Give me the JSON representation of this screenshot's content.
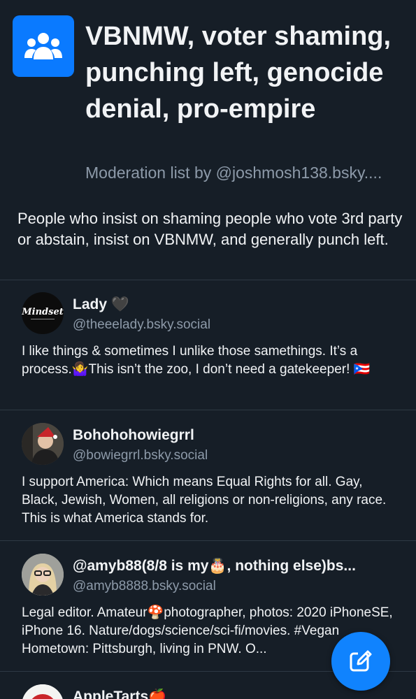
{
  "list": {
    "icon": "people-group-icon",
    "title": "VBNMW, voter shaming, punching left, genocide denial, pro-empire",
    "byline": "Moderation list by @joshmosh138.bsky....",
    "description": "People who insist on shaming people who vote 3rd party or abstain, insist on VBNMW, and generally punch left."
  },
  "members": [
    {
      "name": "Lady 🖤",
      "handle": "@theeelady.bsky.social",
      "bio": "I like things & sometimes I unlike those samethings. It’s a process.🤷‍♀️This isn’t the zoo, I don’t need a gatekeeper! 🇵🇷",
      "avatar_text": "Mindset"
    },
    {
      "name": "Bohohohowiegrrl",
      "handle": "@bowiegrrl.bsky.social",
      "bio": "I support America: Which means Equal Rights for all. Gay, Black, Jewish, Women, all religions or non-religions, any race. This is what America stands for."
    },
    {
      "name": "@amyb88(8/8 is my🎂, nothing else)bs...",
      "handle": "@amyb8888.bsky.social",
      "bio": "Legal editor. Amateur🍄photographer, photos: 2020 iPhoneSE, iPhone 16. Nature/dogs/science/sci-fi/movies. #Vegan Hometown: Pittsburgh, living in PNW. O..."
    },
    {
      "name": "AppleTarts🍎",
      "handle": "",
      "bio": ""
    }
  ],
  "fab": {
    "icon": "compose-icon"
  },
  "colors": {
    "background": "#161e27",
    "accent": "#0a7aff",
    "muted": "#8d9aa9",
    "divider": "#2e3944"
  }
}
